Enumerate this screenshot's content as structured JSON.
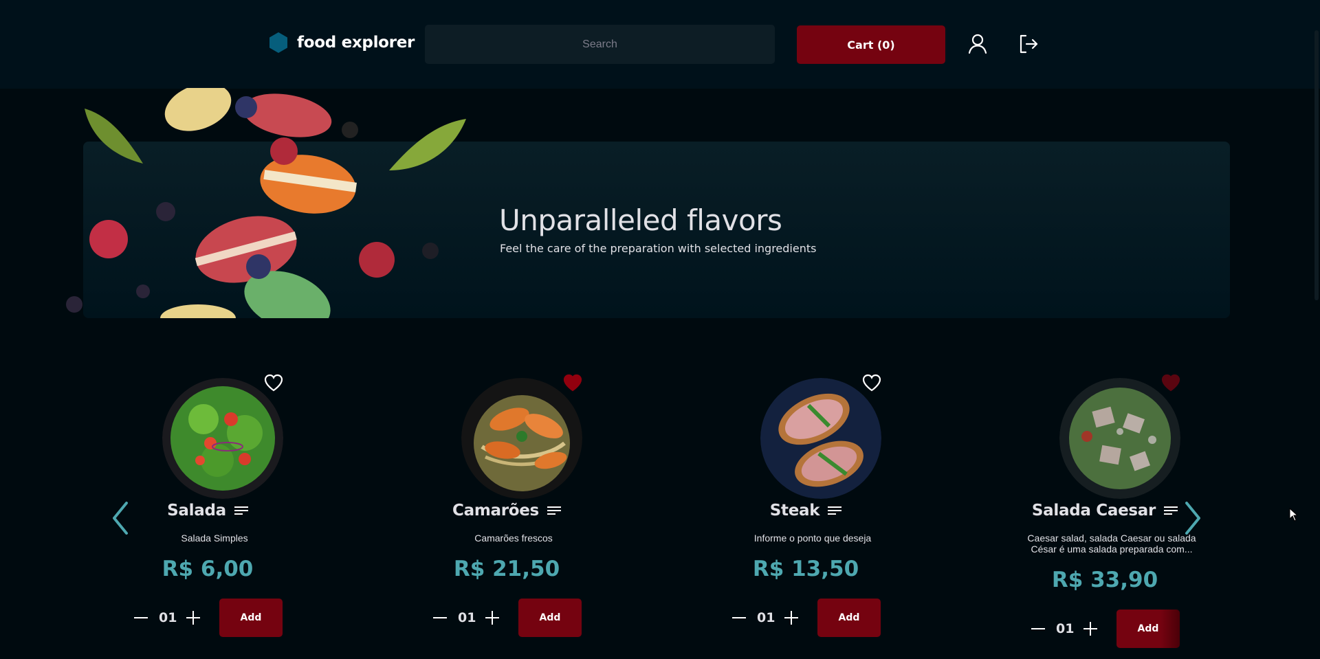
{
  "header": {
    "brand_name": "food explorer",
    "search_placeholder": "Search",
    "cart_label": "Cart (0)",
    "icons": {
      "brand": "hexagon-logo-icon",
      "user": "user-icon",
      "signout": "sign-out-icon"
    }
  },
  "banner": {
    "title": "Unparalleled flavors",
    "subtitle": "Feel the care of the preparation with selected ingredients"
  },
  "carousel": {
    "items": [
      {
        "name": "Salada",
        "description": "Salada Simples",
        "price": "R$ 6,00",
        "quantity": "01",
        "add_label": "Add",
        "favorited": false
      },
      {
        "name": "Camarões",
        "description": "Camarões frescos",
        "price": "R$ 21,50",
        "quantity": "01",
        "add_label": "Add",
        "favorited": true
      },
      {
        "name": "Steak",
        "description": "Informe o ponto que deseja",
        "price": "R$ 13,50",
        "quantity": "01",
        "add_label": "Add",
        "favorited": false
      },
      {
        "name": "Salada Caesar",
        "description": "Caesar salad, salada Caesar ou salada César é uma salada preparada com...",
        "price": "R$ 33,90",
        "quantity": "01",
        "add_label": "Add",
        "favorited": true
      }
    ]
  },
  "colors": {
    "background": "#000a0f",
    "header": "#00111a",
    "accent_red": "#750310",
    "price_teal": "#4ea8b0",
    "text": "#e1e1e6"
  }
}
